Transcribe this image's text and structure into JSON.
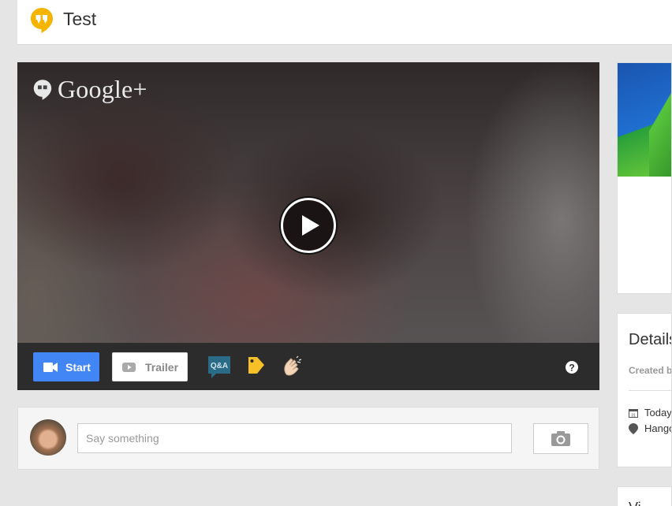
{
  "header": {
    "title": "Test",
    "logo_icon": "hangouts-icon",
    "accent": "#f4b400"
  },
  "video": {
    "brand_text": "Google+",
    "play_icon": "play-icon",
    "start_label": "Start",
    "trailer_label": "Trailer",
    "qa_label": "Q&A",
    "tools": [
      "qa-icon",
      "tag-icon",
      "applause-icon",
      "help-icon"
    ],
    "start_color": "#4285f4"
  },
  "comment": {
    "placeholder": "Say something",
    "camera_icon": "camera-icon"
  },
  "details": {
    "title": "Details",
    "created_by": "Created b",
    "date_text": "Today",
    "location_text": "Hango"
  },
  "bottom_card": {
    "text": "Vi"
  }
}
